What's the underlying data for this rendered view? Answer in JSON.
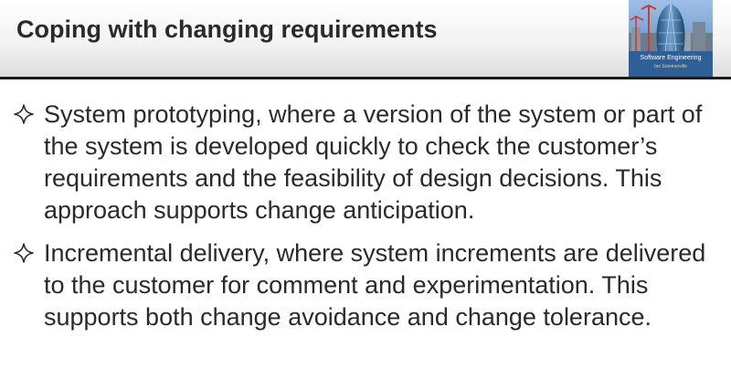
{
  "slide": {
    "title": "Coping with changing requirements",
    "cover": {
      "title": "Software Engineering",
      "author": "Ian Sommerville"
    },
    "bullets": [
      {
        "icon": "four-point-star-outline-icon",
        "text": "System prototyping, where a version of the system or part of the system is developed quickly to check the customer’s requirements and the feasibility of design decisions. This approach supports change anticipation."
      },
      {
        "icon": "four-point-star-outline-icon",
        "text": "Incremental delivery, where system increments are delivered to the customer for comment and experimentation. This supports both change avoidance and change tolerance."
      }
    ]
  },
  "colors": {
    "title_text": "#2a2a2a",
    "body_text": "#2a2a2a",
    "rule": "#1c1c1c",
    "cover_sky": "#5f8cc2",
    "cover_band": "#2e5f97"
  }
}
